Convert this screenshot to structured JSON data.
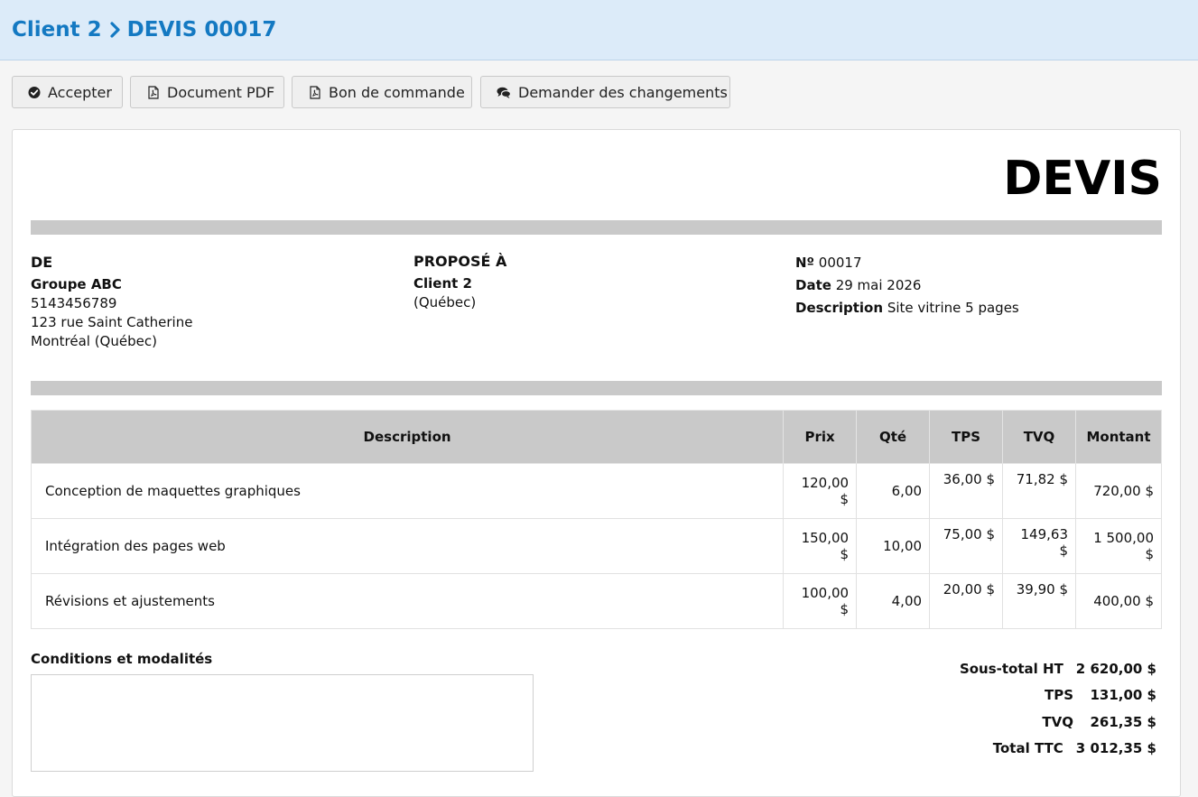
{
  "breadcrumb": {
    "client": "Client 2",
    "document": "DEVIS 00017"
  },
  "toolbar": {
    "accept_label": "Accepter",
    "pdf_label": "Document PDF",
    "order_label": "Bon de commande",
    "changes_label": "Demander des changements"
  },
  "document": {
    "title": "DEVIS",
    "from": {
      "heading": "DE",
      "name": "Groupe ABC",
      "phone": "5143456789",
      "address": "123 rue Saint Catherine",
      "city": "Montréal (Québec)"
    },
    "to": {
      "heading": "PROPOSÉ À",
      "name": "Client 2",
      "region": "(Québec)"
    },
    "meta": {
      "number_label": "Nº",
      "number": "00017",
      "date_label": "Date",
      "date": "29 mai 2026",
      "description_label": "Description",
      "description": "Site vitrine 5 pages"
    },
    "table": {
      "headers": {
        "description": "Description",
        "price": "Prix",
        "qty": "Qté",
        "tps": "TPS",
        "tvq": "TVQ",
        "amount": "Montant"
      },
      "rows": [
        {
          "description": "Conception de maquettes graphiques",
          "price": "120,00 $",
          "qty": "6,00",
          "tps": "36,00 $",
          "tvq": "71,82 $",
          "amount": "720,00 $"
        },
        {
          "description": "Intégration des pages web",
          "price": "150,00 $",
          "qty": "10,00",
          "tps": "75,00 $",
          "tvq": "149,63 $",
          "amount": "1 500,00 $"
        },
        {
          "description": "Révisions et ajustements",
          "price": "100,00 $",
          "qty": "4,00",
          "tps": "20,00 $",
          "tvq": "39,90 $",
          "amount": "400,00 $"
        }
      ]
    },
    "conditions_label": "Conditions et modalités",
    "totals": {
      "subtotal_label": "Sous-total HT",
      "subtotal": "2 620,00 $",
      "tps_label": "TPS",
      "tps": "131,00 $",
      "tvq_label": "TVQ",
      "tvq": "261,35 $",
      "total_label": "Total TTC",
      "total": "3 012,35 $"
    }
  },
  "colors": {
    "accent": "#1479c2",
    "header_bg": "#dcebf9",
    "bar_gray": "#c9c9c9"
  },
  "icons": {
    "accept": "check-circle-icon",
    "pdf": "file-pdf-icon",
    "order": "file-pdf-icon",
    "changes": "comments-icon",
    "breadcrumb_sep": "chevron-right-icon"
  }
}
